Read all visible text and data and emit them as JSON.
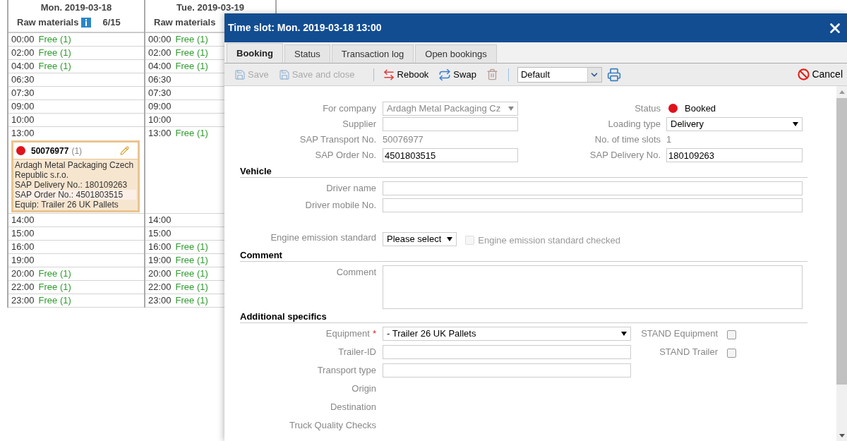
{
  "calendar": {
    "days": [
      {
        "date": "Mon. 2019-03-18",
        "category": "Raw materials",
        "info": true,
        "count": "6/15",
        "slots": [
          {
            "time": "00:00",
            "availability": "Free (1)"
          },
          {
            "time": "02:00",
            "availability": "Free (1)"
          },
          {
            "time": "04:00",
            "availability": "Free (1)"
          },
          {
            "time": "06:30"
          },
          {
            "time": "07:30"
          },
          {
            "time": "09:00"
          },
          {
            "time": "10:00"
          },
          {
            "time": "13:00",
            "booking": {
              "number": "50076977",
              "count": "(1)",
              "lines": [
                {
                  "text": "Ardagh Metal Packaging Czech Republic s.r.o.",
                  "highlighted": false
                },
                {
                  "text": "SAP Delivery No.: 180109263",
                  "highlighted": false
                },
                {
                  "text": "SAP Order No.: 4501803515",
                  "highlighted": true
                },
                {
                  "text": "Equip: Trailer 26 UK Pallets",
                  "highlighted": false
                }
              ]
            }
          },
          {
            "time": "14:00"
          },
          {
            "time": "15:00"
          },
          {
            "time": "16:00"
          },
          {
            "time": "19:00"
          },
          {
            "time": "20:00",
            "availability": "Free (1)"
          },
          {
            "time": "22:00",
            "availability": "Free (1)"
          },
          {
            "time": "23:00",
            "availability": "Free (1)"
          }
        ]
      },
      {
        "date": "Tue. 2019-03-19",
        "category": "Raw materials",
        "slots": [
          {
            "time": "00:00",
            "availability": "Free (1)"
          },
          {
            "time": "02:00",
            "availability": "Free (1)"
          },
          {
            "time": "04:00",
            "availability": "Free (1)"
          },
          {
            "time": "06:30"
          },
          {
            "time": "07:30"
          },
          {
            "time": "09:00"
          },
          {
            "time": "10:00"
          },
          {
            "time": "13:00",
            "availability": "Free (1)"
          },
          {
            "time": "14:00"
          },
          {
            "time": "15:00"
          },
          {
            "time": "16:00",
            "availability": "Free (1)"
          },
          {
            "time": "19:00",
            "availability": "Free (1)"
          },
          {
            "time": "20:00",
            "availability": "Free (1)"
          },
          {
            "time": "22:00",
            "availability": "Free (1)"
          },
          {
            "time": "23:00",
            "availability": "Free (1)"
          }
        ]
      }
    ]
  },
  "dialog": {
    "title": "Time slot: Mon. 2019-03-18 13:00",
    "tabs": [
      {
        "label": "Booking",
        "selected": true
      },
      {
        "label": "Status",
        "selected": false
      },
      {
        "label": "Transaction log",
        "selected": false
      },
      {
        "label": "Open bookings",
        "selected": false
      }
    ],
    "toolbar": {
      "buttons": [
        {
          "kind": "save",
          "label": "Save",
          "disabled": true
        },
        {
          "kind": "save",
          "label": "Save and close",
          "disabled": true
        },
        {
          "kind": "rebook",
          "label": "Rebook",
          "disabled": false
        },
        {
          "kind": "swap",
          "label": "Swap",
          "disabled": false
        },
        {
          "kind": "delete",
          "disabled": true
        }
      ],
      "view_select": "Default",
      "cancel": "Cancel"
    },
    "sections": [
      {
        "kind": "pairs",
        "rows": [
          {
            "left": {
              "label": "For company",
              "kind": "select",
              "value": "Ardagh Metal Packaging Cz",
              "disabled": true
            },
            "right": {
              "label": "Status",
              "kind": "status",
              "value": "Booked"
            }
          },
          {
            "left": {
              "label": "Supplier",
              "kind": "input"
            },
            "right": {
              "label": "Loading type",
              "kind": "select",
              "value": "Delivery",
              "disabled": false
            }
          },
          {
            "left": {
              "label": "SAP Transport No.",
              "kind": "text",
              "value": "50076977"
            },
            "right": {
              "label": "No. of time slots",
              "kind": "text",
              "value": "1"
            }
          },
          {
            "left": {
              "label": "SAP Order No.",
              "kind": "input",
              "value": "4501803515"
            },
            "right": {
              "label": "SAP Delivery No.",
              "kind": "input",
              "value": "180109263"
            }
          }
        ]
      },
      {
        "kind": "single",
        "heading": "Vehicle",
        "rows": [
          {
            "left": {
              "label": "Driver name",
              "kind": "input"
            }
          },
          {
            "left": {
              "label": "Driver mobile No.",
              "kind": "input"
            }
          },
          {
            "left": {
              "label": "Engine emission standard",
              "kind": "small_select",
              "value": "Please select",
              "check": {
                "label": "Engine emission standard checked",
                "checked": false,
                "disabled": true
              }
            }
          }
        ]
      },
      {
        "kind": "single",
        "heading": "Comment",
        "rows": [
          {
            "left": {
              "label": "Comment",
              "kind": "textarea"
            }
          }
        ]
      },
      {
        "kind": "wide_pairs",
        "heading": "Additional specifics",
        "rows": [
          {
            "left": {
              "label": "Equipment",
              "required_mark": "*",
              "kind": "select",
              "value": "- Trailer 26 UK Pallets",
              "disabled": false
            },
            "right": {
              "label": "STAND Equipment",
              "kind": "checkbox",
              "checked": false
            }
          },
          {
            "left": {
              "label": "Trailer-ID",
              "kind": "input"
            },
            "right": {
              "label": "STAND Trailer",
              "kind": "checkbox",
              "checked": false
            }
          },
          {
            "left": {
              "label": "Transport type",
              "kind": "input"
            }
          },
          {
            "left": {
              "label": "Origin",
              "kind": "label"
            }
          },
          {
            "left": {
              "label": "Destination",
              "kind": "label"
            }
          },
          {
            "left": {
              "label": "Truck Quality Checks",
              "kind": "label"
            }
          }
        ]
      }
    ]
  }
}
